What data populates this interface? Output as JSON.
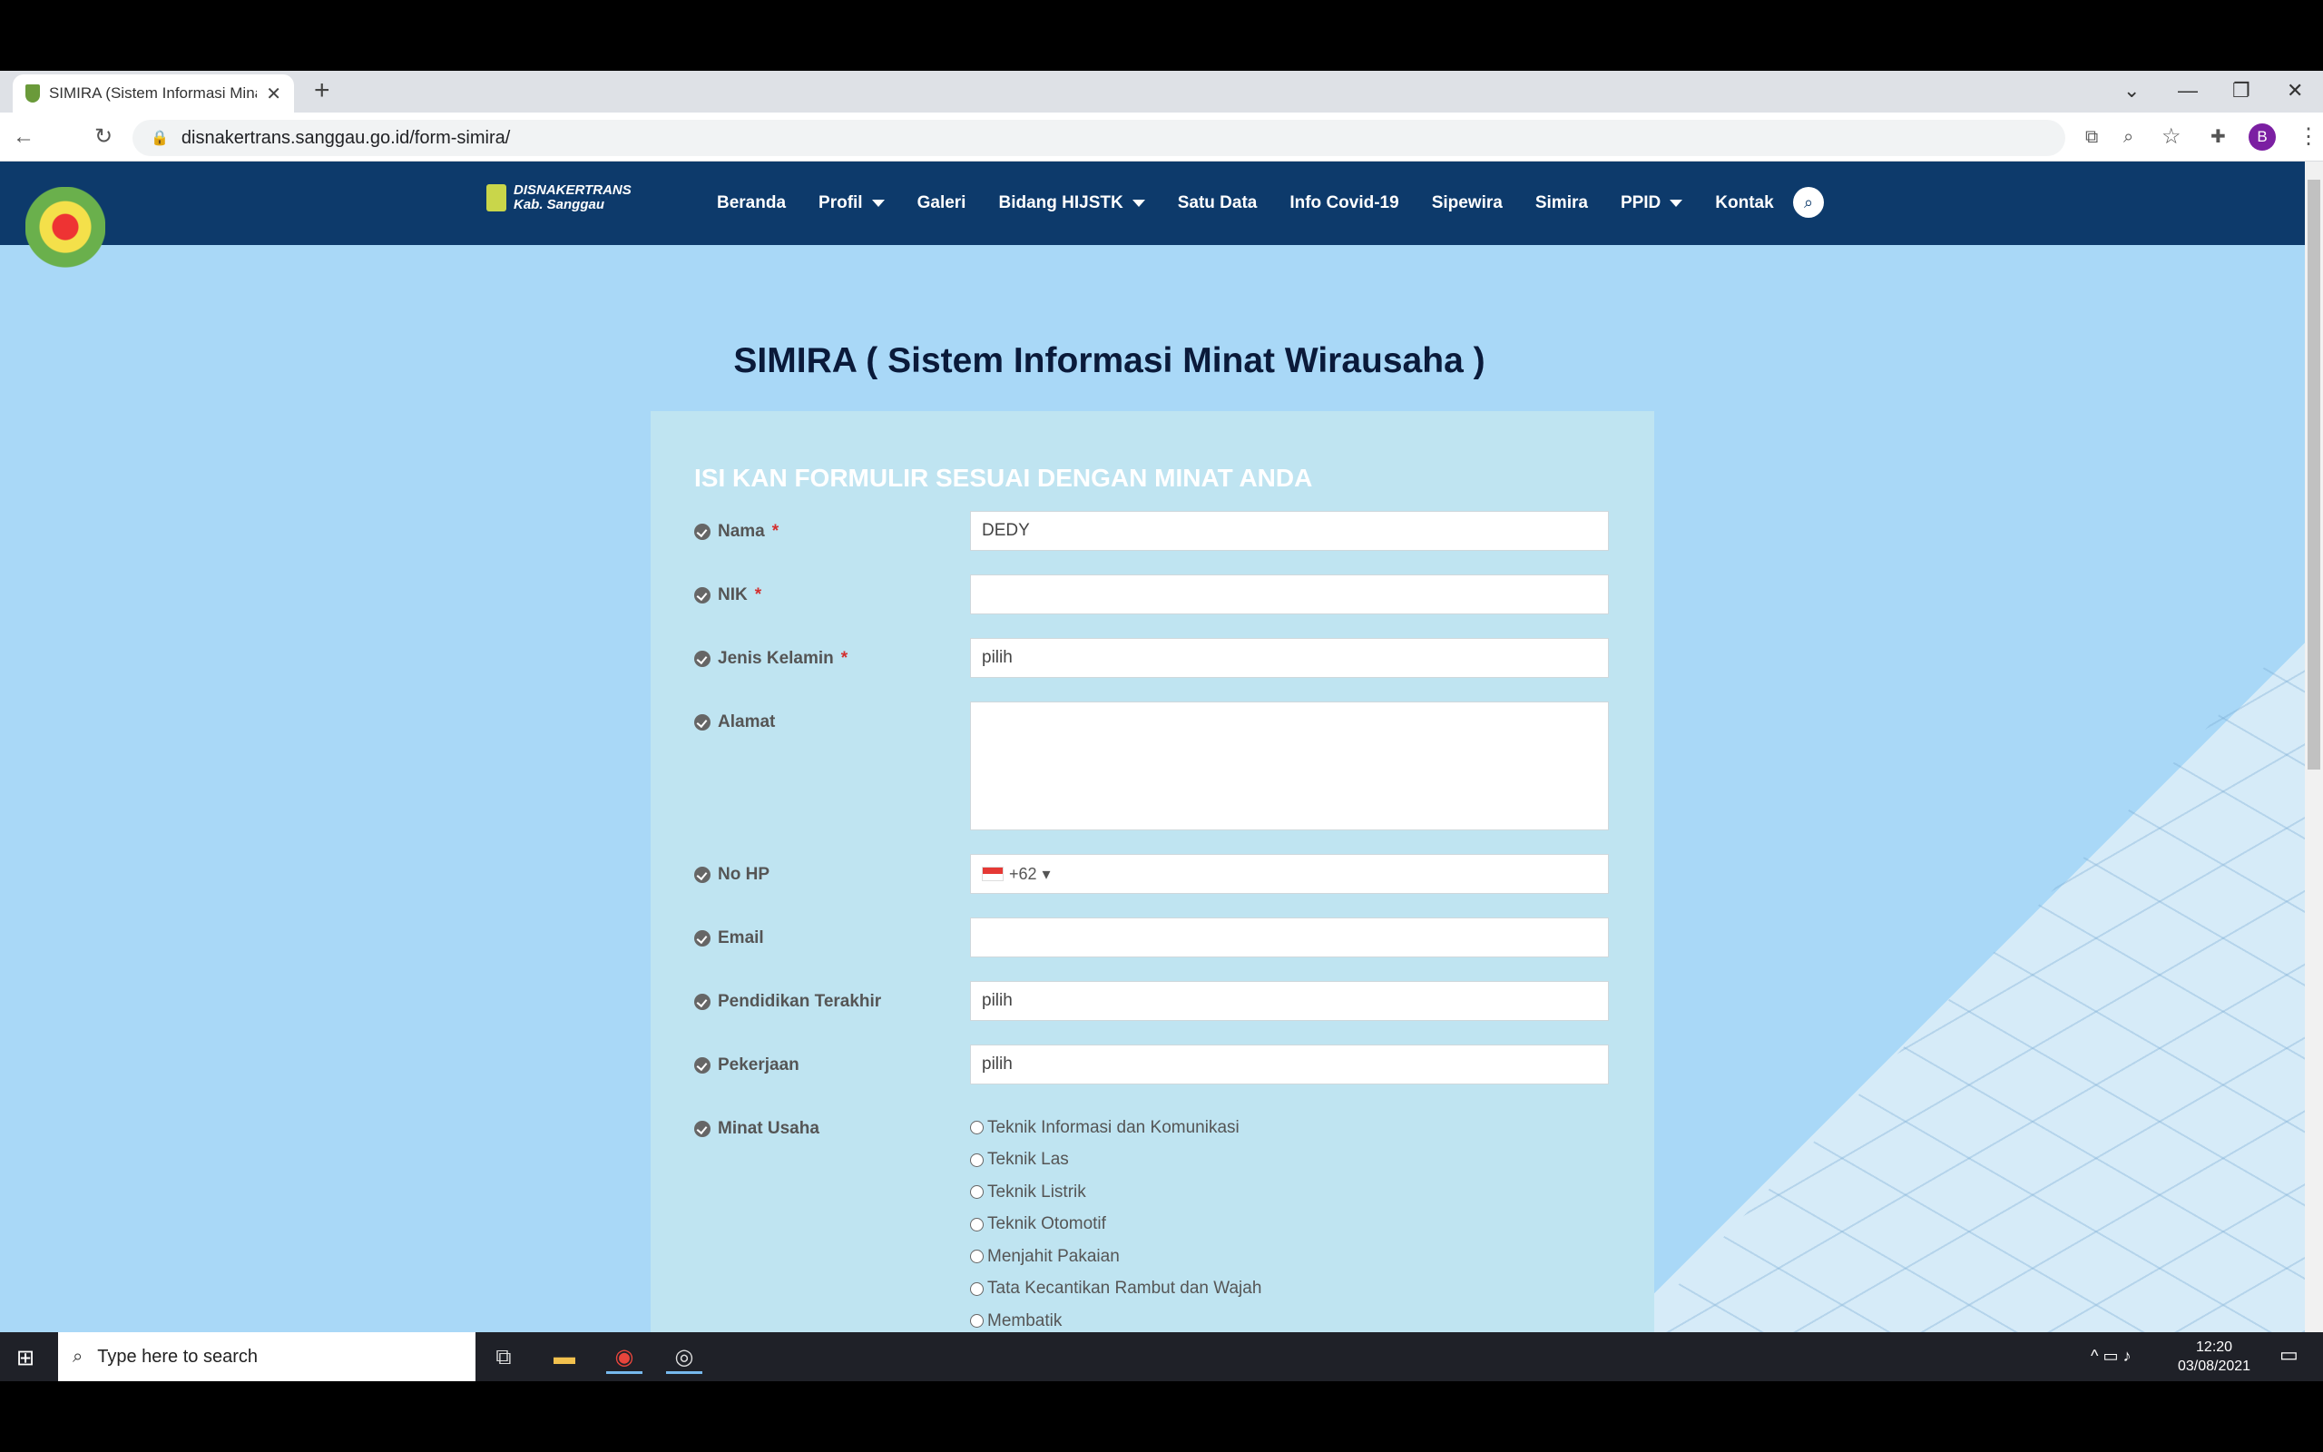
{
  "browser": {
    "tab_title": "SIMIRA (Sistem Informasi Minat",
    "url": "disnakertrans.sanggau.go.id/form-simira/",
    "profile_initial": "B"
  },
  "site": {
    "brand_line1": "DISNAKERTRANS",
    "brand_line2": "Kab. Sanggau",
    "nav": [
      {
        "label": "Beranda"
      },
      {
        "label": "Profil"
      },
      {
        "label": "Galeri"
      },
      {
        "label": "Bidang HIJSTK"
      },
      {
        "label": "Satu Data"
      },
      {
        "label": "Info Covid-19"
      },
      {
        "label": "Sipewira"
      },
      {
        "label": "Simira"
      },
      {
        "label": "PPID"
      },
      {
        "label": "Kontak"
      }
    ]
  },
  "form": {
    "page_title": "SIMIRA ( Sistem Informasi Minat Wirausaha )",
    "heading": "ISI KAN FORMULIR SESUAI DENGAN MINAT ANDA",
    "fields": {
      "nama": {
        "label": "Nama",
        "required": "*",
        "value": "DEDY"
      },
      "nik": {
        "label": "NIK",
        "required": "*",
        "value": ""
      },
      "jenis_kelamin": {
        "label": "Jenis Kelamin",
        "required": "*",
        "value": "pilih"
      },
      "alamat": {
        "label": "Alamat",
        "value": ""
      },
      "no_hp": {
        "label": "No HP",
        "prefix": "+62"
      },
      "email": {
        "label": "Email",
        "value": ""
      },
      "pendidikan": {
        "label": "Pendidikan Terakhir",
        "value": "pilih"
      },
      "pekerjaan": {
        "label": "Pekerjaan",
        "value": "pilih"
      },
      "minat": {
        "label": "Minat Usaha"
      }
    },
    "minat_options": [
      "Teknik Informasi dan Komunikasi",
      "Teknik Las",
      "Teknik Listrik",
      "Teknik Otomotif",
      "Menjahit Pakaian",
      "Tata Kecantikan Rambut dan Wajah",
      "Membatik"
    ]
  },
  "taskbar": {
    "search_placeholder": "Type here to search",
    "time": "12:20",
    "date": "03/08/2021"
  }
}
